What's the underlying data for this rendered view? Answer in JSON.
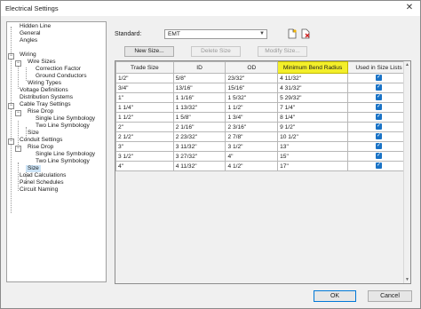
{
  "window": {
    "title": "Electrical Settings",
    "close_glyph": "✕"
  },
  "tree": [
    {
      "label": "Hidden Line"
    },
    {
      "label": "General"
    },
    {
      "label": "Angles"
    },
    {
      "label": "Wiring"
    },
    {
      "label": "Wire Sizes"
    },
    {
      "label": "Correction Factor"
    },
    {
      "label": "Ground Conductors"
    },
    {
      "label": "Wiring Types"
    },
    {
      "label": "Voltage Definitions"
    },
    {
      "label": "Distribution Systems"
    },
    {
      "label": "Cable Tray Settings"
    },
    {
      "label": "Rise Drop"
    },
    {
      "label": "Single Line Symbology"
    },
    {
      "label": "Two Line Symbology"
    },
    {
      "label": "Size"
    },
    {
      "label": "Conduit Settings"
    },
    {
      "label": "Rise Drop"
    },
    {
      "label": "Single Line Symbology"
    },
    {
      "label": "Two Line Symbology"
    },
    {
      "label": "Size"
    },
    {
      "label": "Load Calculations"
    },
    {
      "label": "Panel Schedules"
    },
    {
      "label": "Circuit Naming"
    }
  ],
  "standard": {
    "label": "Standard:",
    "value": "EMT"
  },
  "buttons": {
    "new_size": "New Size...",
    "delete_size": "Delete Size",
    "modify_size": "Modify Size..."
  },
  "table": {
    "headers": [
      "Trade Size",
      "ID",
      "OD",
      "Minimum Bend Radius",
      "Used in Size Lists"
    ],
    "rows": [
      [
        "1/2\"",
        "5/8\"",
        "23/32\"",
        "4 11/32\""
      ],
      [
        "3/4\"",
        "13/16\"",
        "15/16\"",
        "4 31/32\""
      ],
      [
        "1\"",
        "1 1/16\"",
        "1 5/32\"",
        "5 29/32\""
      ],
      [
        "1 1/4\"",
        "1 13/32\"",
        "1 1/2\"",
        "7 1/4\""
      ],
      [
        "1 1/2\"",
        "1 5/8\"",
        "1 3/4\"",
        "8 1/4\""
      ],
      [
        "2\"",
        "2 1/16\"",
        "2 3/16\"",
        "9 1/2\""
      ],
      [
        "2 1/2\"",
        "2 23/32\"",
        "2 7/8\"",
        "10 1/2\""
      ],
      [
        "3\"",
        "3 11/32\"",
        "3 1/2\"",
        "13\""
      ],
      [
        "3 1/2\"",
        "3 27/32\"",
        "4\"",
        "15\""
      ],
      [
        "4\"",
        "4 11/32\"",
        "4 1/2\"",
        "17\""
      ]
    ]
  },
  "checkbox_glyph": "✓",
  "dialog": {
    "ok": "OK",
    "cancel": "Cancel"
  },
  "colors": {
    "highlight": "#f3ef2a",
    "checkbox": "#1a73c6",
    "selection": "#cce4f7"
  }
}
